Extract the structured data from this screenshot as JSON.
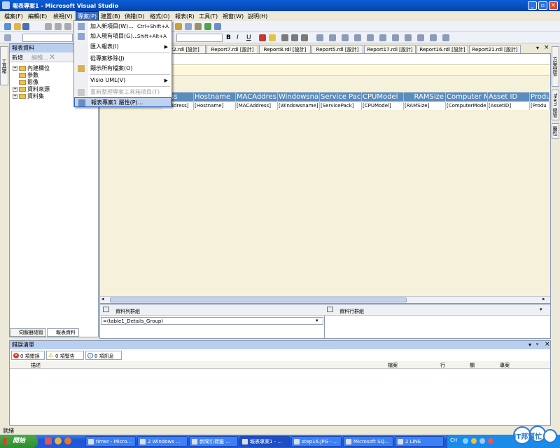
{
  "window": {
    "title": "報表專案1 - Microsoft Visual Studio"
  },
  "menubar": [
    "檔案(F)",
    "編輯(E)",
    "檢視(V)",
    "專案(P)",
    "建置(B)",
    "偵錯(D)",
    "格式(O)",
    "報表(R)",
    "工具(T)",
    "視窗(W)",
    "說明(H)"
  ],
  "project_menu": {
    "items": [
      {
        "label": "加入新項目(W)...",
        "shortcut": "Ctrl+Shift+A"
      },
      {
        "label": "加入現有項目(G)...",
        "shortcut": "Shift+Alt+A"
      },
      {
        "label": "匯入報表(I)"
      },
      {
        "label": "從專案移除(J)"
      },
      {
        "label": "顯示所有檔案(O)"
      },
      {
        "label": "Visio UML(V)"
      },
      {
        "label": "重新整理專案工具箱項目(T)"
      },
      {
        "label": "報表專案1 屬性(P)..."
      }
    ]
  },
  "report_data_panel": {
    "title": "報表資料",
    "new_label": "新增",
    "edit_label": "編輯...",
    "tree": [
      "內建欄位",
      "參數",
      "影像",
      "資料來源",
      "資料集"
    ]
  },
  "left_bottom_tabs": [
    "伺服器總管",
    "報表資料"
  ],
  "document_tabs": [
    "Report22.rdl [設計]",
    "Report7.rdl [設計]",
    "Report8.rdl [設計]",
    "Report5.rdl [設計]",
    "Report17.rdl [設計]",
    "Report16.rdl [設計]",
    "Report21.rdl [設計]"
  ],
  "doc_tab_first_partial": "rt22.rdl [設計]",
  "table": {
    "headers": [
      "ress",
      "Hostname",
      "MACAddres",
      "Windowsna",
      "Service Pac",
      "CPUModel",
      "RAMSize",
      "Computer M",
      "Asset ID",
      "Produ"
    ],
    "cells": [
      "IPAddress]",
      "[Hostname]",
      "[MACAddress]",
      "[Windowsname]",
      "[ServicePack]",
      "[CPUModel]",
      "[RAMSize]",
      "[ComputerMode",
      "[AssetID]",
      "[Produ"
    ]
  },
  "groups": {
    "row_label": "資料列群組",
    "col_label": "資料行群組",
    "row_group_value": "=(table1_Details_Group)"
  },
  "error_list": {
    "title": "錯誤清單",
    "errors": "0 項錯誤",
    "warnings": "0 項警告",
    "messages": "0 項訊息",
    "columns": [
      "描述",
      "檔案",
      "行",
      "欄",
      "專案"
    ]
  },
  "statusbar": {
    "text": "就緒"
  },
  "right_tabs": [
    "方案總管",
    "Team 總管",
    "屬性"
  ],
  "left_vtab": "工具箱",
  "taskbar": {
    "start": "開始",
    "items": [
      "timer - Micro...",
      "2 Windows ...",
      "新聞引標籤 ...",
      "報表專案1 - ...",
      "step16.JPG - ...",
      "Microsoft SQ...",
      "2 LINE"
    ],
    "lang": "CH"
  },
  "watermark": {
    "text": "iT邦幫忙"
  }
}
